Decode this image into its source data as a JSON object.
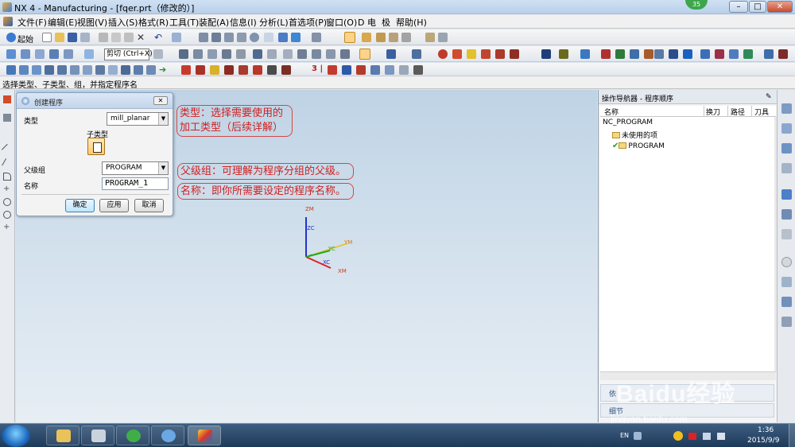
{
  "window": {
    "title": "NX 4 - Manufacturing - [fqer.prt（修改的）]",
    "badge": "35",
    "controls": [
      "–",
      "□",
      "✕"
    ]
  },
  "menu": [
    "文件(F)",
    "编辑(E)",
    "视图(V)",
    "插入(S)",
    "格式(R)",
    "工具(T)",
    "装配(A)",
    "信息(I)",
    "分析(L)",
    "首选项(P)",
    "窗口(O)",
    "D 电",
    "极",
    "帮助(H)"
  ],
  "toolbar": {
    "start_label": "起始",
    "tooltip": "剪切 (Ctrl+X)",
    "row3_text": "3 |"
  },
  "status_text": "选择类型、子类型、组，并指定程序名",
  "dialog": {
    "title": "创建程序",
    "close": "✕",
    "type_label": "类型",
    "type_value": "mill_planar",
    "subtype_label": "子类型",
    "parent_label": "父级组",
    "parent_value": "PROGRAM",
    "name_label": "名称",
    "name_value": "PROGRAM_1",
    "ok": "确定",
    "apply": "应用",
    "cancel": "取消"
  },
  "annotations": {
    "type_line1": "类型：选择需要使用的",
    "type_line2": "加工类型（后续详解）",
    "parent": "父级组：可理解为程序分组的父级。",
    "name": "名称：即你所需要设定的程序名称。"
  },
  "axes": {
    "zm": "ZM",
    "zc": "ZC",
    "ym": "YM",
    "yc": "YC",
    "xc": "XC",
    "xm": "XM"
  },
  "navigator": {
    "title": "操作导航器 - 程序顺序",
    "columns": [
      "名称",
      "换刀",
      "路径",
      "刀具"
    ],
    "root": "NC_PROGRAM",
    "items": [
      "未使用的项",
      "PROGRAM"
    ],
    "detail1": "依",
    "detail2": "细节"
  },
  "taskbar": {
    "lang": "EN",
    "time": "1:36",
    "date": "2015/9/9"
  },
  "watermark": {
    "brand": "Baidu经验",
    "url": "jingyan.baidu.com"
  }
}
